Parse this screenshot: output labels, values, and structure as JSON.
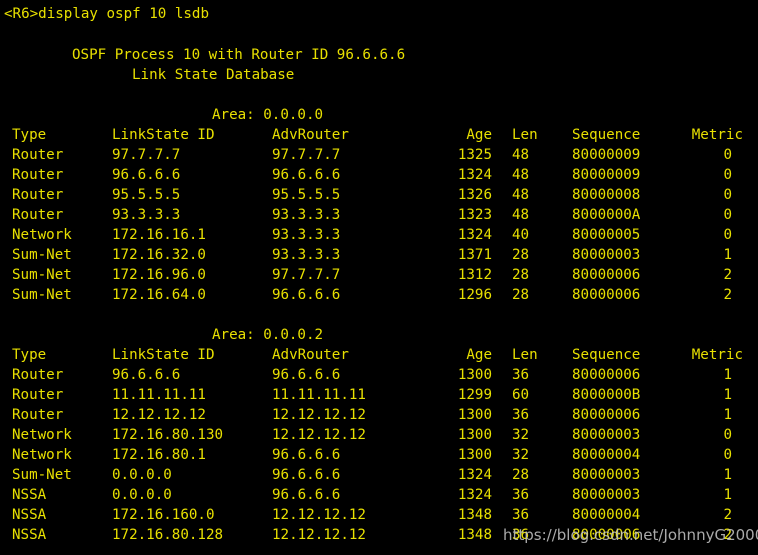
{
  "terminal": {
    "command_line": "<R6>display ospf 10 lsdb",
    "process_title": "OSPF Process 10 with Router ID 96.6.6.6",
    "db_title": "Link State Database",
    "headers": {
      "type": "Type",
      "linkstate_id": "LinkState ID",
      "adv_router": "AdvRouter",
      "age": "Age",
      "len": "Len",
      "sequence": "Sequence",
      "metric": "Metric"
    },
    "areas": [
      {
        "label": "Area: 0.0.0.0",
        "rows": [
          {
            "type": "Router",
            "id": "97.7.7.7",
            "adv": "97.7.7.7",
            "age": "1325",
            "len": "48",
            "seq": "80000009",
            "metric": "0"
          },
          {
            "type": "Router",
            "id": "96.6.6.6",
            "adv": "96.6.6.6",
            "age": "1324",
            "len": "48",
            "seq": "80000009",
            "metric": "0"
          },
          {
            "type": "Router",
            "id": "95.5.5.5",
            "adv": "95.5.5.5",
            "age": "1326",
            "len": "48",
            "seq": "80000008",
            "metric": "0"
          },
          {
            "type": "Router",
            "id": "93.3.3.3",
            "adv": "93.3.3.3",
            "age": "1323",
            "len": "48",
            "seq": "8000000A",
            "metric": "0"
          },
          {
            "type": "Network",
            "id": "172.16.16.1",
            "adv": "93.3.3.3",
            "age": "1324",
            "len": "40",
            "seq": "80000005",
            "metric": "0"
          },
          {
            "type": "Sum-Net",
            "id": "172.16.32.0",
            "adv": "93.3.3.3",
            "age": "1371",
            "len": "28",
            "seq": "80000003",
            "metric": "1"
          },
          {
            "type": "Sum-Net",
            "id": "172.16.96.0",
            "adv": "97.7.7.7",
            "age": "1312",
            "len": "28",
            "seq": "80000006",
            "metric": "2"
          },
          {
            "type": "Sum-Net",
            "id": "172.16.64.0",
            "adv": "96.6.6.6",
            "age": "1296",
            "len": "28",
            "seq": "80000006",
            "metric": "2"
          }
        ]
      },
      {
        "label": "Area: 0.0.0.2",
        "rows": [
          {
            "type": "Router",
            "id": "96.6.6.6",
            "adv": "96.6.6.6",
            "age": "1300",
            "len": "36",
            "seq": "80000006",
            "metric": "1"
          },
          {
            "type": "Router",
            "id": "11.11.11.11",
            "adv": "11.11.11.11",
            "age": "1299",
            "len": "60",
            "seq": "8000000B",
            "metric": "1"
          },
          {
            "type": "Router",
            "id": "12.12.12.12",
            "adv": "12.12.12.12",
            "age": "1300",
            "len": "36",
            "seq": "80000006",
            "metric": "1"
          },
          {
            "type": "Network",
            "id": "172.16.80.130",
            "adv": "12.12.12.12",
            "age": "1300",
            "len": "32",
            "seq": "80000003",
            "metric": "0"
          },
          {
            "type": "Network",
            "id": "172.16.80.1",
            "adv": "96.6.6.6",
            "age": "1300",
            "len": "32",
            "seq": "80000004",
            "metric": "0"
          },
          {
            "type": "Sum-Net",
            "id": "0.0.0.0",
            "adv": "96.6.6.6",
            "age": "1324",
            "len": "28",
            "seq": "80000003",
            "metric": "1"
          },
          {
            "type": "NSSA",
            "id": "0.0.0.0",
            "adv": "96.6.6.6",
            "age": "1324",
            "len": "36",
            "seq": "80000003",
            "metric": "1"
          },
          {
            "type": "NSSA",
            "id": "172.16.160.0",
            "adv": "12.12.12.12",
            "age": "1348",
            "len": "36",
            "seq": "80000004",
            "metric": "2"
          },
          {
            "type": "NSSA",
            "id": "172.16.80.128",
            "adv": "12.12.12.12",
            "age": "1348",
            "len": "36",
            "seq": "80000006",
            "metric": "2"
          }
        ]
      }
    ]
  },
  "watermark": "https://blog.csdn.net/JohnnyG2000",
  "colors": {
    "background": "#000000",
    "text": "#e8e000"
  }
}
